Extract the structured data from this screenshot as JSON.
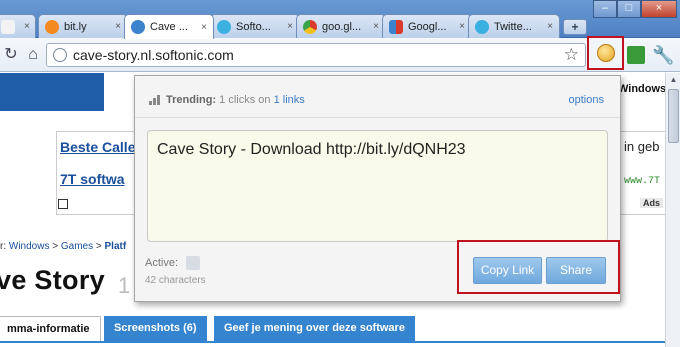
{
  "browser": {
    "tabs": [
      {
        "label": "",
        "favicon_color": "#f2f2f2",
        "close": "×"
      },
      {
        "label": "bit.ly",
        "favicon_color": "#f38a1f",
        "close": "×"
      },
      {
        "label": "Cave ...",
        "favicon_color": "#3c82cc",
        "close": "×"
      },
      {
        "label": "Softo...",
        "favicon_color": "#3ab0e0",
        "close": "×"
      },
      {
        "label": "goo.gl...",
        "favicon_color": "#f4c11d",
        "close": "×"
      },
      {
        "label": "Googl...",
        "favicon_color": "#d83b2b",
        "close": "×"
      },
      {
        "label": "Twitte...",
        "favicon_color": "#3ab0e0",
        "close": "×"
      }
    ],
    "new_tab": "+",
    "window_controls": {
      "minimize": "–",
      "maximize": "□",
      "close": "×"
    },
    "omnibox": {
      "url": "cave-story.nl.softonic.com"
    },
    "extension_icon": "bitly-smiley-icon"
  },
  "page": {
    "header_right_text": "Windows",
    "ad_links": [
      {
        "text": "Beste Calle",
        "right": "in geb"
      },
      {
        "text": "7T softwa",
        "url": "www.7T"
      }
    ],
    "ads_tag": "Ads",
    "breadcrumb": {
      "prefix": "r:",
      "items": [
        "Windows",
        "Games",
        "Platf"
      ],
      "separator": ">"
    },
    "title": "ve Story",
    "title_suffix": "1",
    "tabs": [
      {
        "label": "mma-informatie",
        "active": true
      },
      {
        "label": "Screenshots (6)",
        "active": false
      },
      {
        "label": "Geef je mening over deze software",
        "active": false
      }
    ]
  },
  "popup": {
    "trending_label": "Trending:",
    "trending_text": " 1 clicks on ",
    "trending_link": "1 links",
    "options": "options",
    "tweet_text": "Cave Story - Download http://bit.ly/dQNH23",
    "active_label": "Active:",
    "char_count": "42 characters",
    "copy_button": "Copy Link",
    "share_button": "Share"
  }
}
